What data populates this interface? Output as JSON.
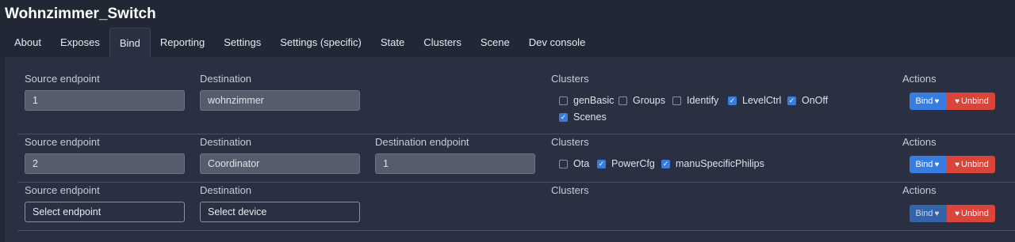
{
  "device_title": "Wohnzimmer_Switch",
  "tabs": [
    "About",
    "Exposes",
    "Bind",
    "Reporting",
    "Settings",
    "Settings (specific)",
    "State",
    "Clusters",
    "Scene",
    "Dev console"
  ],
  "labels": {
    "source_endpoint": "Source endpoint",
    "destination": "Destination",
    "destination_endpoint": "Destination endpoint",
    "clusters": "Clusters",
    "actions": "Actions"
  },
  "buttons": {
    "bind": "Bind",
    "unbind": "Unbind"
  },
  "rows": [
    {
      "source_endpoint": "1",
      "destination": "wohnzimmer",
      "clusters": [
        {
          "name": "genBasic",
          "checked": false
        },
        {
          "name": "Groups",
          "checked": false
        },
        {
          "name": "Identify",
          "checked": false
        },
        {
          "name": "LevelCtrl",
          "checked": true
        },
        {
          "name": "OnOff",
          "checked": true
        },
        {
          "name": "Scenes",
          "checked": true
        }
      ]
    },
    {
      "source_endpoint": "2",
      "destination": "Coordinator",
      "destination_endpoint": "1",
      "clusters": [
        {
          "name": "Ota",
          "checked": false
        },
        {
          "name": "PowerCfg",
          "checked": true
        },
        {
          "name": "manuSpecificPhilips",
          "checked": true
        }
      ]
    },
    {
      "source_endpoint": "Select endpoint",
      "destination": "Select device"
    }
  ],
  "colors": {
    "bind": "#3a7be0",
    "unbind": "#d9453b",
    "background": "#222736",
    "panel": "#2a3042"
  }
}
